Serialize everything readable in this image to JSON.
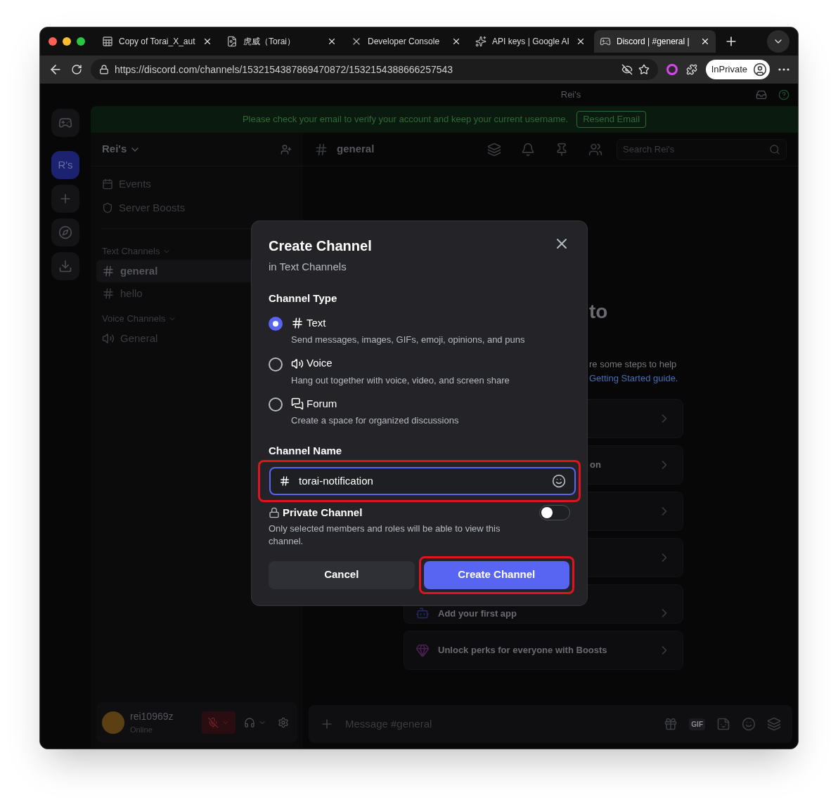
{
  "browser": {
    "tabs": [
      {
        "title": "Copy of Torai_X_aut",
        "kind": "sheet",
        "selected": false
      },
      {
        "title": "虎威（Torai）",
        "kind": "page",
        "selected": false
      },
      {
        "title": "Developer Console",
        "kind": "x",
        "selected": false
      },
      {
        "title": "API keys | Google AI",
        "kind": "ai",
        "selected": false
      },
      {
        "title": "Discord | #general |",
        "kind": "discord",
        "selected": true
      }
    ],
    "url": "https://discord.com/channels/1532154387869470872/1532154388666257543",
    "profile": "InPrivate"
  },
  "titlebar": {
    "title": "Rei's"
  },
  "banner": {
    "text": "Please check your email to verify your account and keep your current username.",
    "button": "Resend Email"
  },
  "rail": {
    "server": {
      "label": "R's",
      "selected": true
    }
  },
  "server": {
    "name": "Rei's",
    "items": [
      "Events",
      "Server Boosts"
    ],
    "categories": [
      {
        "name": "Text Channels",
        "channels": [
          {
            "name": "general",
            "kind": "text",
            "selected": true
          },
          {
            "name": "hello",
            "kind": "text",
            "selected": false
          }
        ]
      },
      {
        "name": "Voice Channels",
        "channels": [
          {
            "name": "General",
            "kind": "voice",
            "selected": false
          }
        ]
      }
    ]
  },
  "user": {
    "name": "rei10969z",
    "status": "Online",
    "muted": true
  },
  "channel": {
    "name": "general",
    "search_placeholder": "Search Rei's",
    "message_placeholder": "Message #general",
    "gif_label": "GIF"
  },
  "welcome": {
    "heading": "to",
    "lines": [
      "re some steps to help"
    ],
    "link": "Getting Started guide.",
    "cards": [
      {
        "kind": "covered"
      },
      {
        "kind": "covered",
        "text": "on"
      },
      {
        "kind": "covered"
      },
      {
        "kind": "covered"
      },
      {
        "kind": "app",
        "text": "Add your first app"
      },
      {
        "kind": "boost",
        "text": "Unlock perks for everyone with Boosts"
      }
    ]
  },
  "dialog": {
    "title": "Create Channel",
    "subtitle": "in Text Channels",
    "type_label": "Channel Type",
    "types": [
      {
        "kind": "text",
        "label": "Text",
        "description": "Send messages, images, GIFs, emoji, opinions, and puns",
        "selected": true
      },
      {
        "kind": "voice",
        "label": "Voice",
        "description": "Hang out together with voice, video, and screen share",
        "selected": false
      },
      {
        "kind": "forum",
        "label": "Forum",
        "description": "Create a space for organized discussions",
        "selected": false
      }
    ],
    "name_label": "Channel Name",
    "name_value": "torai-notification",
    "name_highlighted": true,
    "private": {
      "label": "Private Channel",
      "description": "Only selected members and roles will be able to view this channel.",
      "on": false
    },
    "cancel": "Cancel",
    "create": "Create Channel",
    "create_highlighted": true
  }
}
